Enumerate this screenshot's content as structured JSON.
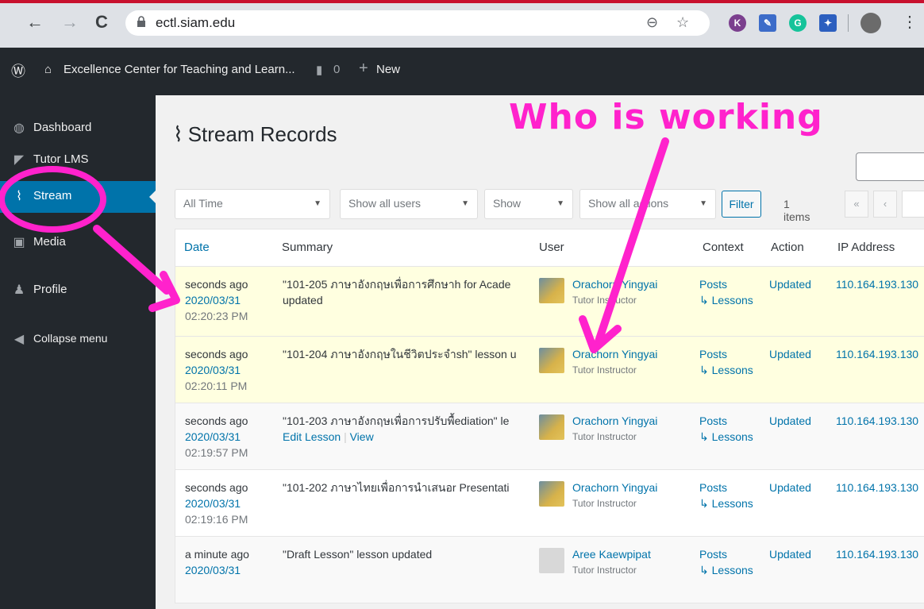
{
  "browser": {
    "url": "ectl.siam.edu",
    "nav": {
      "back": "←",
      "forward": "→",
      "reload": "C"
    },
    "extensions": [
      {
        "label": "K",
        "color": "#7b3f8e"
      },
      {
        "label": "",
        "color": "#3c6cc9"
      },
      {
        "label": "G",
        "color": "#15c39a"
      },
      {
        "label": "",
        "color": "#2c5fbf"
      },
      {
        "label": "",
        "color": "#5f6368"
      }
    ]
  },
  "adminbar": {
    "site_name": "Excellence Center for Teaching and Learn...",
    "comments": "0",
    "new_label": "New"
  },
  "sidebar": {
    "items": [
      {
        "label": "Dashboard",
        "icon": "dashboard-icon"
      },
      {
        "label": "Tutor LMS",
        "icon": "graduation-cap-icon"
      },
      {
        "label": "Stream",
        "icon": "pulse-icon",
        "active": true
      },
      {
        "label": "Media",
        "icon": "media-icon"
      },
      {
        "label": "Profile",
        "icon": "user-icon"
      },
      {
        "label": "Collapse menu",
        "icon": "collapse-icon"
      }
    ]
  },
  "main": {
    "title": "Stream Records",
    "filters": {
      "time": "All Time",
      "users": "Show all users",
      "show": "Show",
      "actions": "Show all actions",
      "filter_label": "Filter",
      "items_count": "1 items"
    },
    "pager": {
      "first": "«",
      "prev": "‹"
    },
    "columns": [
      "Date",
      "Summary",
      "User",
      "Context",
      "Action",
      "IP Address"
    ],
    "rows": [
      {
        "ago": "seconds ago",
        "date": "2020/03/31",
        "time": "02:20:23 PM",
        "summary": "\"101-205 ภาษาอังกฤษเพื่อการศึกษาh for Acade",
        "summary2": "updated",
        "user": "Orachorn Yingyai",
        "role": "Tutor Instructor",
        "context": "Posts",
        "subcontext": "↳ Lessons",
        "action": "Updated",
        "ip": "110.164.193.130"
      },
      {
        "ago": "seconds ago",
        "date": "2020/03/31",
        "time": "02:20:11 PM",
        "summary": "\"101-204 ภาษาอังกฤษในชีวิตประจำsh\" lesson u",
        "summary2": "",
        "user": "Orachorn Yingyai",
        "role": "Tutor Instructor",
        "context": "Posts",
        "subcontext": "↳ Lessons",
        "action": "Updated",
        "ip": "110.164.193.130"
      },
      {
        "ago": "seconds ago",
        "date": "2020/03/31",
        "time": "02:19:57 PM",
        "summary": "\"101-203 ภาษาอังกฤษเพื่อการปรับพื้ediation\" le",
        "edit_link": "Edit Lesson",
        "view_link": "View",
        "user": "Orachorn Yingyai",
        "role": "Tutor Instructor",
        "context": "Posts",
        "subcontext": "↳ Lessons",
        "action": "Updated",
        "ip": "110.164.193.130"
      },
      {
        "ago": "seconds ago",
        "date": "2020/03/31",
        "time": "02:19:16 PM",
        "summary": "\"101-202 ภาษาไทยเพื่อการนำเสนอr Presentati",
        "summary2": "",
        "user": "Orachorn Yingyai",
        "role": "Tutor Instructor",
        "context": "Posts",
        "subcontext": "↳ Lessons",
        "action": "Updated",
        "ip": "110.164.193.130"
      },
      {
        "ago": "a minute ago",
        "date": "2020/03/31",
        "time": "",
        "summary": "\"Draft Lesson\" lesson updated",
        "summary2": "",
        "user": "Aree Kaewpipat",
        "role": "Tutor Instructor",
        "context": "Posts",
        "subcontext": "↳ Lessons",
        "action": "Updated",
        "ip": "110.164.193.130"
      }
    ]
  },
  "annotation": {
    "text": "Who is working",
    "color": "#ff22cc"
  }
}
